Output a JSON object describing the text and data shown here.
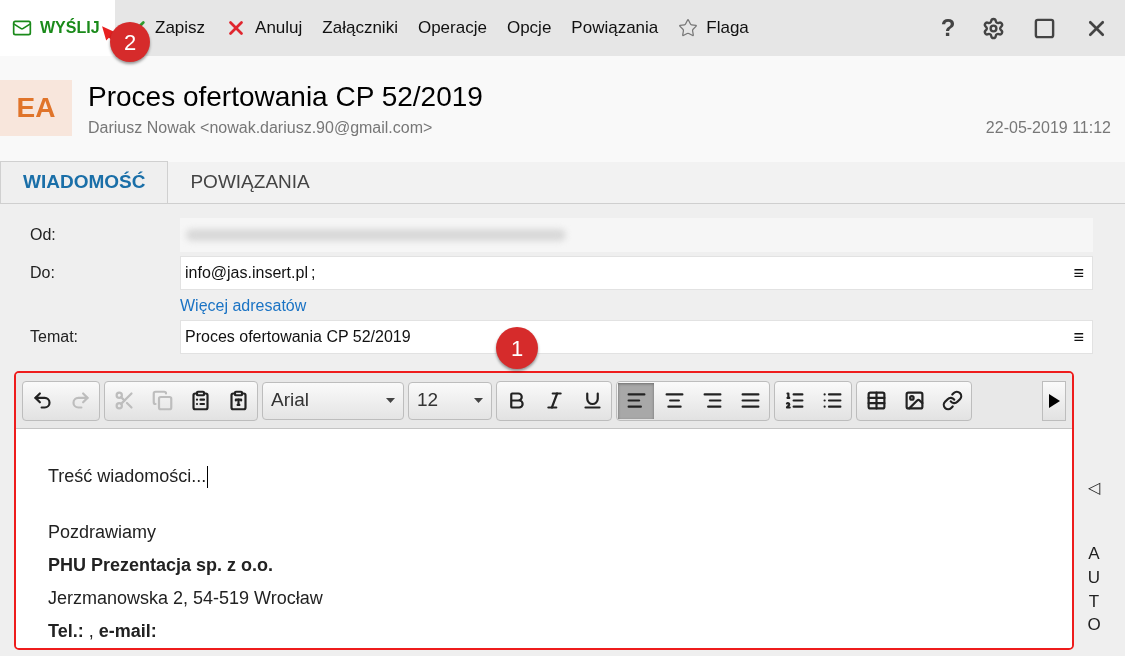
{
  "toolbar": {
    "send": {
      "label": "WYŚLIJ"
    },
    "items": [
      {
        "kind": "check",
        "label": "Zapisz"
      },
      {
        "kind": "cross",
        "label": "Anuluj"
      },
      {
        "kind": "plain",
        "label": "Załączniki"
      },
      {
        "kind": "plain",
        "label": "Operacje"
      },
      {
        "kind": "plain",
        "label": "Opcje"
      },
      {
        "kind": "plain",
        "label": "Powiązania"
      },
      {
        "kind": "star",
        "label": "Flaga"
      }
    ],
    "help": "?"
  },
  "header": {
    "avatar": "EA",
    "subject": "Proces ofertowania CP 52/2019",
    "sender": "Dariusz Nowak <nowak.dariusz.90@gmail.com>",
    "date": "22-05-2019 11:12"
  },
  "tabs": [
    {
      "label": "WIADOMOŚĆ",
      "selected": true
    },
    {
      "label": "POWIĄZANIA",
      "selected": false
    }
  ],
  "form": {
    "from_label": "Od:",
    "to_label": "Do:",
    "to_value": "info@jas.insert.pl",
    "to_separator": ";",
    "more_recipients": "Więcej adresatów",
    "subject_label": "Temat:",
    "subject_value": "Proces ofertowania CP 52/2019",
    "menu_glyph": "≡"
  },
  "editor_toolbar": {
    "groups": [
      [
        {
          "kind": "undo",
          "disabled": false
        },
        {
          "kind": "redo",
          "disabled": true
        }
      ],
      [
        {
          "kind": "cut",
          "disabled": true
        },
        {
          "kind": "copy",
          "disabled": true
        },
        {
          "kind": "paste",
          "disabled": false
        },
        {
          "kind": "paste-text",
          "disabled": false
        }
      ],
      [
        {
          "kind": "font",
          "value": "Arial"
        }
      ],
      [
        {
          "kind": "size",
          "value": "12"
        }
      ],
      [
        {
          "kind": "bold",
          "disabled": false
        },
        {
          "kind": "italic",
          "disabled": false
        },
        {
          "kind": "underline",
          "disabled": false
        }
      ],
      [
        {
          "kind": "align-left",
          "selected": true
        },
        {
          "kind": "align-center",
          "selected": false
        },
        {
          "kind": "align-right",
          "selected": false
        },
        {
          "kind": "justify",
          "selected": false
        }
      ],
      [
        {
          "kind": "ordered-list",
          "disabled": false
        },
        {
          "kind": "bullet-list",
          "disabled": false
        }
      ],
      [
        {
          "kind": "table",
          "disabled": false
        },
        {
          "kind": "image",
          "disabled": false
        },
        {
          "kind": "link",
          "disabled": false
        }
      ]
    ]
  },
  "editor_body": {
    "message": "Treść wiadomości...",
    "greeting": "Pozdrawiamy",
    "company": "PHU Prezentacja sp. z o.o.",
    "address": "Jerzmanowska 2, 54-519 Wrocław",
    "contact": "**Tel.:** , **e-mail:**"
  },
  "side_panel": {
    "toggle": "◁",
    "label": "AUTO"
  },
  "annotations": [
    {
      "label": "1"
    },
    {
      "label": "2"
    }
  ]
}
